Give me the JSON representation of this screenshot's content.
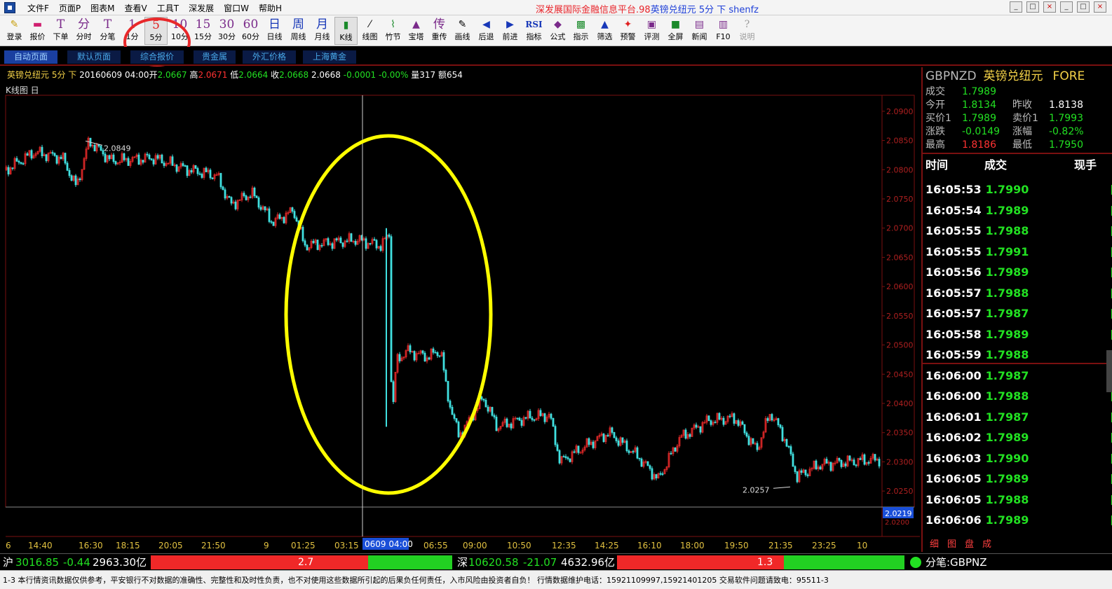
{
  "menubar": {
    "menus": [
      "文件F",
      "页面P",
      "图表M",
      "查看V",
      "工具T",
      "深发展",
      "窗口W",
      "帮助H"
    ],
    "title_red": "深发展国际金融信息平台.98",
    "title_blue": "英镑兑纽元 5分 下 shenfz",
    "window_buttons": [
      "_",
      "□",
      "×",
      "_",
      "□",
      "×"
    ]
  },
  "toolbar": {
    "buttons": [
      {
        "icon": "✎",
        "label": "登录"
      },
      {
        "icon": "▬",
        "label": "报价"
      },
      {
        "icon": "T",
        "label": "下单"
      },
      {
        "icon": "分",
        "label": "分时"
      },
      {
        "icon": "T",
        "label": "分笔"
      },
      {
        "icon": "1",
        "label": "1分"
      },
      {
        "icon": "5",
        "label": "5分"
      },
      {
        "icon": "10",
        "label": "10分"
      },
      {
        "icon": "15",
        "label": "15分"
      },
      {
        "icon": "30",
        "label": "30分"
      },
      {
        "icon": "60",
        "label": "60分"
      },
      {
        "icon": "日",
        "label": "日线"
      },
      {
        "icon": "周",
        "label": "周线"
      },
      {
        "icon": "月",
        "label": "月线"
      },
      {
        "icon": "▮",
        "label": "K线"
      },
      {
        "icon": "⁄",
        "label": "线图"
      },
      {
        "icon": "⌇",
        "label": "竹节"
      },
      {
        "icon": "▲",
        "label": "宝塔"
      },
      {
        "icon": "传",
        "label": "重传"
      },
      {
        "icon": "✎",
        "label": "画线"
      },
      {
        "icon": "◀",
        "label": "后退"
      },
      {
        "icon": "▶",
        "label": "前进"
      },
      {
        "icon": "RSI",
        "label": "指标"
      },
      {
        "icon": "◆",
        "label": "公式"
      },
      {
        "icon": "▩",
        "label": "指示"
      },
      {
        "icon": "▲",
        "label": "筛选"
      },
      {
        "icon": "✦",
        "label": "预警"
      },
      {
        "icon": "▣",
        "label": "评测"
      },
      {
        "icon": "■",
        "label": "全屏"
      },
      {
        "icon": "▤",
        "label": "新闻"
      },
      {
        "icon": "▥",
        "label": "F10"
      },
      {
        "icon": "?",
        "label": "说明"
      }
    ]
  },
  "page_tabs": [
    "自动页面",
    "默认页面",
    "综合报价",
    "贵金属",
    "外汇价格",
    "上海黄金"
  ],
  "infoline": {
    "symbol": "英镑兑纽元 5分 下",
    "date": "20160609 04:00",
    "open_label": "开",
    "open": "2.0667",
    "high_label": "高",
    "high": "2.0671",
    "low_label": "低",
    "low": "2.0664",
    "close_label": "收",
    "close": "2.0668",
    "last": "2.0668",
    "change": "-0.0001",
    "change_pct": "-0.00%",
    "vol_label": "量",
    "vol": "317",
    "amt_label": "额",
    "amt": "654"
  },
  "chart": {
    "label": "K线图 日",
    "y_ticks": [
      "2.0900",
      "2.0850",
      "2.0800",
      "2.0750",
      "2.0700",
      "2.0650",
      "2.0600",
      "2.0550",
      "2.0500",
      "2.0450",
      "2.0400",
      "2.0350",
      "2.0300",
      "2.0250"
    ],
    "x_ticks": [
      "6",
      "14:40",
      "16:30",
      "18:15",
      "20:05",
      "21:50",
      "9",
      "01:25",
      "03:15",
      "06:55",
      "09:00",
      "10:50",
      "12:35",
      "14:25",
      "16:10",
      "18:00",
      "19:50",
      "21:35",
      "23:25",
      "10"
    ],
    "cursor_label": "0609 04:00",
    "max_label": "2.0849",
    "min_label": "2.0257",
    "right_box": "2.0219",
    "right_box_below": "2.0200",
    "colors": {
      "up": "#e02828",
      "down": "#40e0e0",
      "grid": "#7a1010",
      "highlight": "#ffff00"
    }
  },
  "chart_data": {
    "type": "candlestick",
    "series": "GBPNZD 5min",
    "ylim": [
      2.02,
      2.092
    ],
    "max": 2.0849,
    "min": 2.0257
  },
  "quote": {
    "code": "GBPNZD",
    "name": "英镑兑纽元",
    "market": "FORE",
    "rows": [
      {
        "k": "成交",
        "v": "1.7989",
        "v_color": "#22e022"
      },
      {
        "k": "今开",
        "v": "1.8134",
        "v_color": "#22e022",
        "k2": "昨收",
        "v2": "1.8138",
        "v2_color": "#ffffff"
      },
      {
        "k": "买价1",
        "v": "1.7989",
        "v_color": "#22e022",
        "k2": "卖价1",
        "v2": "1.7993",
        "v2_color": "#22e022"
      },
      {
        "k": "涨跌",
        "v": "-0.0149",
        "v_color": "#22e022",
        "k2": "涨幅",
        "v2": "-0.82%",
        "v2_color": "#22e022"
      },
      {
        "k": "最高",
        "v": "1.8186",
        "v_color": "#ff3232",
        "k2": "最低",
        "v2": "1.7950",
        "v2_color": "#22e022"
      }
    ]
  },
  "ticks": {
    "headers": [
      "时间",
      "成交",
      "现手"
    ],
    "rows": [
      [
        "16:05:53",
        "1.7990"
      ],
      [
        "16:05:54",
        "1.7989"
      ],
      [
        "16:05:55",
        "1.7988"
      ],
      [
        "16:05:55",
        "1.7991"
      ],
      [
        "16:05:56",
        "1.7989"
      ],
      [
        "16:05:57",
        "1.7988"
      ],
      [
        "16:05:57",
        "1.7987"
      ],
      [
        "16:05:58",
        "1.7989"
      ],
      [
        "16:05:59",
        "1.7988"
      ],
      [
        "16:06:00",
        "1.7987"
      ],
      [
        "16:06:00",
        "1.7988"
      ],
      [
        "16:06:01",
        "1.7987"
      ],
      [
        "16:06:02",
        "1.7989"
      ],
      [
        "16:06:03",
        "1.7990"
      ],
      [
        "16:06:05",
        "1.7989"
      ],
      [
        "16:06:05",
        "1.7988"
      ],
      [
        "16:06:06",
        "1.7989"
      ]
    ],
    "side_tabs": [
      "细",
      "图",
      "盘",
      "成"
    ]
  },
  "status": {
    "sh_label": "沪",
    "sh_index": "3016.85",
    "sh_change": "-0.44",
    "sh_amount": "2963.30亿",
    "sh_ratio_num": "2.7",
    "sh_ratio_red": 0.72,
    "sz_label": "深",
    "sz_index": "10620.58",
    "sz_change": "-21.07",
    "sz_amount": "4632.96亿",
    "sz_ratio_num": "1.3",
    "sz_ratio_red": 0.58,
    "right_text": "分笔:GBPNZ"
  },
  "disclaimer": "1-3    本行情资讯数据仅供参考，平安银行不对数据的准确性、完整性和及时性负责，也不对使用这些数据所引起的后果负任何责任，入市风险由投资者自负！  行情数据维护电话：15921109997,15921401205       交易软件问题请致电：95511-3"
}
